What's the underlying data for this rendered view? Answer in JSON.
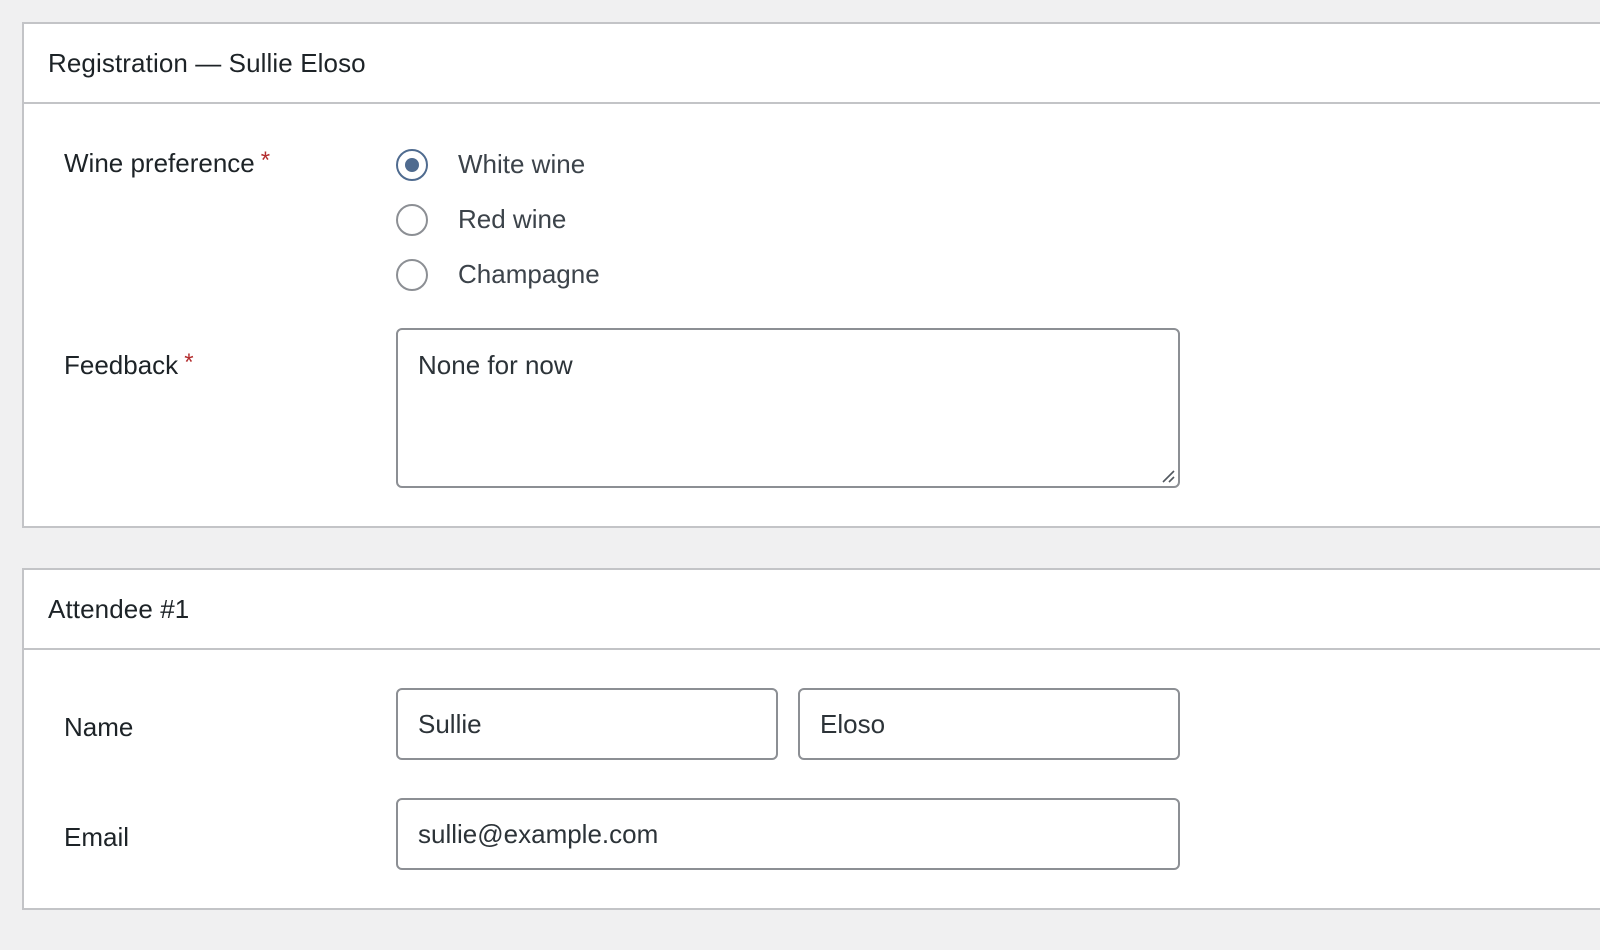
{
  "registration": {
    "title": "Registration — Sullie Eloso",
    "wine": {
      "label": "Wine preference",
      "required_mark": "*",
      "options": [
        {
          "label": "White wine",
          "checked": true
        },
        {
          "label": "Red wine",
          "checked": false
        },
        {
          "label": "Champagne",
          "checked": false
        }
      ]
    },
    "feedback": {
      "label": "Feedback",
      "required_mark": "*",
      "value": "None for now"
    }
  },
  "attendee": {
    "title": "Attendee #1",
    "name": {
      "label": "Name",
      "first": "Sullie",
      "last": "Eloso"
    },
    "email": {
      "label": "Email",
      "value": "sullie@example.com"
    }
  },
  "colors": {
    "background": "#f0f0f1",
    "border": "#c3c4c7",
    "input_border": "#8c8f94",
    "radio_accent": "#4f6b8f",
    "required": "#b32d2e"
  }
}
